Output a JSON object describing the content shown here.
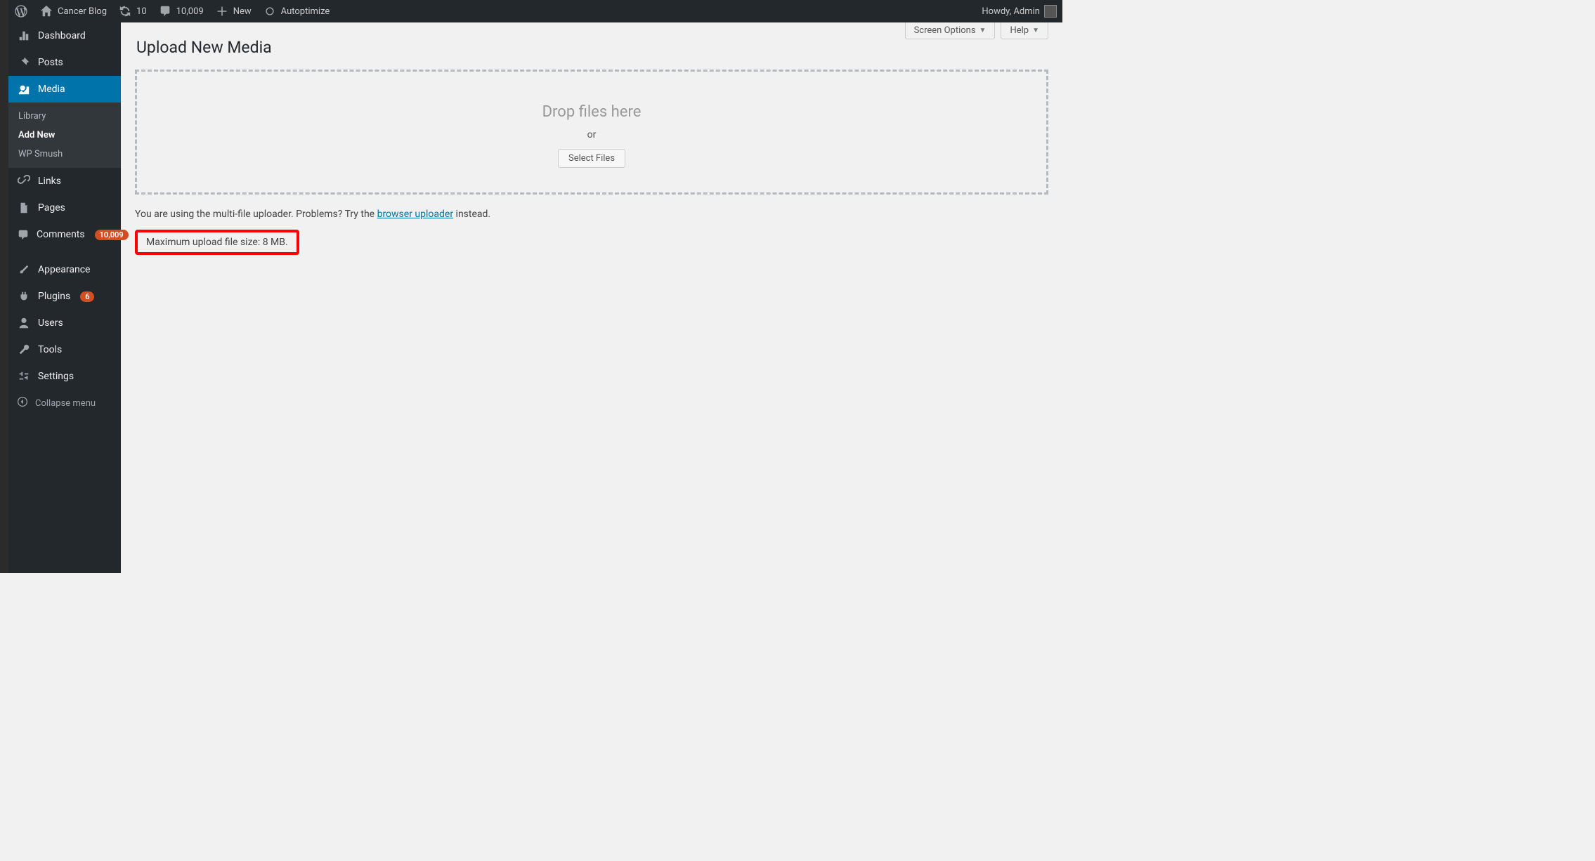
{
  "adminbar": {
    "site_name": "Cancer Blog",
    "updates_count": "10",
    "comments_count": "10,009",
    "new_label": "New",
    "autoptimize_label": "Autoptimize",
    "howdy": "Howdy, Admin"
  },
  "sidebar": {
    "dashboard": "Dashboard",
    "posts": "Posts",
    "media": "Media",
    "media_sub": {
      "library": "Library",
      "add_new": "Add New",
      "wp_smush": "WP Smush"
    },
    "links": "Links",
    "pages": "Pages",
    "comments": "Comments",
    "comments_badge": "10,009",
    "appearance": "Appearance",
    "plugins": "Plugins",
    "plugins_badge": "6",
    "users": "Users",
    "tools": "Tools",
    "settings": "Settings",
    "collapse": "Collapse menu"
  },
  "tabs": {
    "screen_options": "Screen Options",
    "help": "Help"
  },
  "page": {
    "title": "Upload New Media",
    "drop_text": "Drop files here",
    "or_text": "or",
    "select_btn": "Select Files",
    "uploader_notice_a": "You are using the multi-file uploader. Problems? Try the ",
    "uploader_link": "browser uploader",
    "uploader_notice_b": " instead.",
    "max_upload": "Maximum upload file size: 8 MB."
  }
}
